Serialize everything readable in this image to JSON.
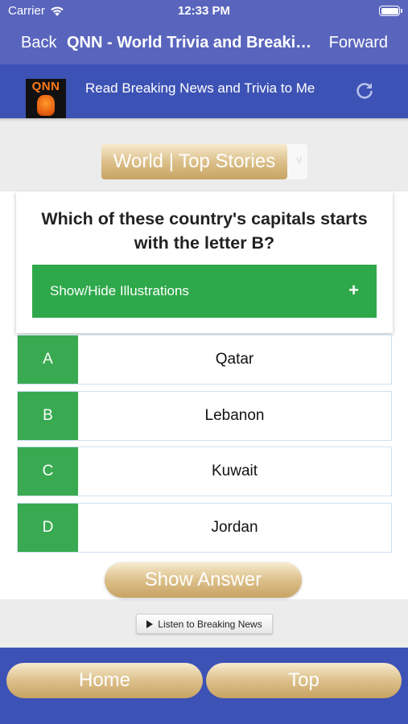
{
  "status_bar": {
    "carrier": "Carrier",
    "time": "12:33 PM"
  },
  "nav": {
    "back_label": "Back",
    "title": "QNN - World Trivia and Breaking News",
    "forward_label": "Forward"
  },
  "header": {
    "logo_text": "QNN",
    "read_link": "Read Breaking News and Trivia to Me"
  },
  "category": {
    "selected": "World | Top Stories",
    "chevron": "v"
  },
  "question": {
    "text": "Which of these country's capitals starts with the letter B?",
    "illustrations_toggle": "Show/Hide Illustrations",
    "toggle_symbol": "+"
  },
  "answers": [
    {
      "letter": "A",
      "text": "Qatar"
    },
    {
      "letter": "B",
      "text": "Lebanon"
    },
    {
      "letter": "C",
      "text": "Kuwait"
    },
    {
      "letter": "D",
      "text": "Jordan"
    }
  ],
  "show_answer_label": "Show Answer",
  "listen_label": "Listen to Breaking News",
  "bottom_nav": {
    "home": "Home",
    "top": "Top"
  },
  "colors": {
    "nav_bar": "#5965bd",
    "header_bar": "#3d52b5",
    "answer_green": "#39aa51",
    "gold_button": "#dcc08a"
  },
  "icons": [
    "wifi-icon",
    "battery-icon",
    "refresh-icon",
    "play-icon"
  ]
}
